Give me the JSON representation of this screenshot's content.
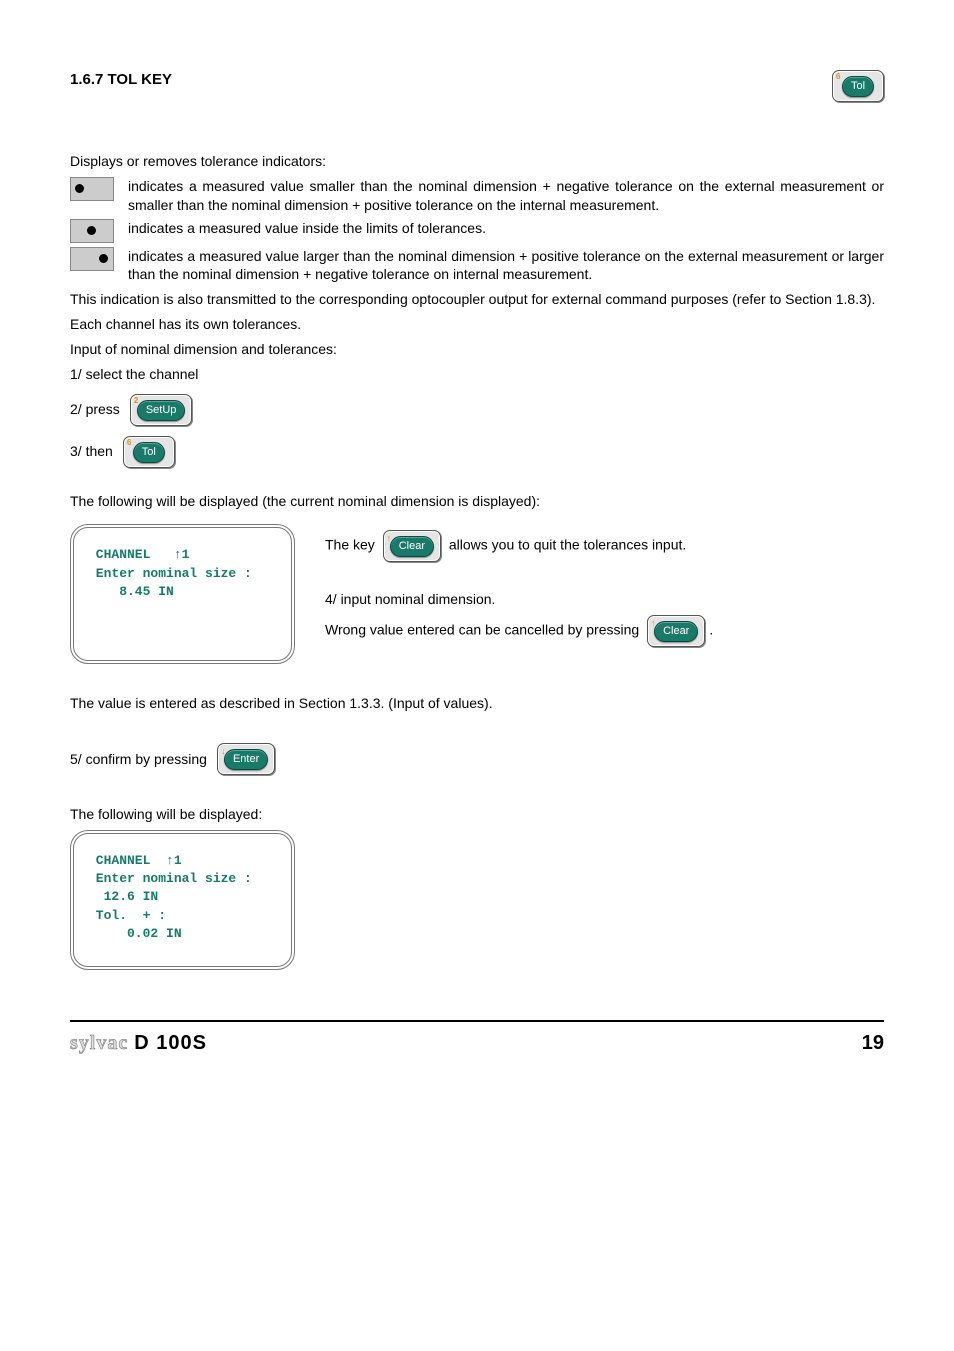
{
  "heading": "1.6.7 TOL KEY",
  "topKey": {
    "corner": "6",
    "label": "Tol"
  },
  "intro": "Displays or removes tolerance indicators:",
  "indicators": {
    "left": "indicates a measured value smaller than the nominal dimension + negative tolerance on the external measurement or smaller than the nominal dimension + positive tolerance on the internal measurement.",
    "center": "indicates a measured value inside the limits of tolerances.",
    "right": "indicates a measured value larger than the nominal dimension + positive tolerance on the external measurement or larger than the nominal dimension + negative tolerance on internal measurement."
  },
  "para1": "This indication is also transmitted to the corresponding optocoupler output for external command purposes (refer to Section 1.8.3).",
  "para2": "Each channel has its own tolerances.",
  "para3": "Input of nominal dimension and tolerances:",
  "step1": "1/ select the channel",
  "step2": {
    "prefix": "2/ press",
    "key": {
      "corner": "2",
      "label": "SetUp"
    }
  },
  "step3": {
    "prefix": "3/ then",
    "key": {
      "corner": "6",
      "label": "Tol"
    }
  },
  "para4": "The following will be displayed (the current nominal dimension is displayed):",
  "lcd1": {
    "l1": " CHANNEL   ↑1",
    "l2": " Enter nominal size :",
    "l3": "    8.45 IN"
  },
  "side": {
    "keyLine": {
      "prefix": "The key",
      "key": {
        "arrow": "↑",
        "label": "Clear"
      },
      "suffix": "allows you to quit the tolerances input."
    },
    "step4a": "4/ input nominal dimension.",
    "step4b": {
      "prefix": "Wrong value entered can be cancelled by pressing",
      "key": {
        "arrow": "↑",
        "label": "Clear"
      },
      "suffix": "."
    }
  },
  "para5": "The value is entered as described in Section 1.3.3. (Input of values).",
  "step5": {
    "prefix": "5/ confirm by pressing",
    "key": {
      "arrow": "↓",
      "label": "Enter"
    }
  },
  "para6": "The following will be displayed:",
  "lcd2": {
    "l1": " CHANNEL  ↑1",
    "l2": " Enter nominal size :",
    "l3": "  12.6 IN",
    "l4": " Tol.  + :",
    "l5": "     0.02 IN"
  },
  "footer": {
    "brand1": "sylvac",
    "brand2": "D 100S",
    "page": "19"
  }
}
